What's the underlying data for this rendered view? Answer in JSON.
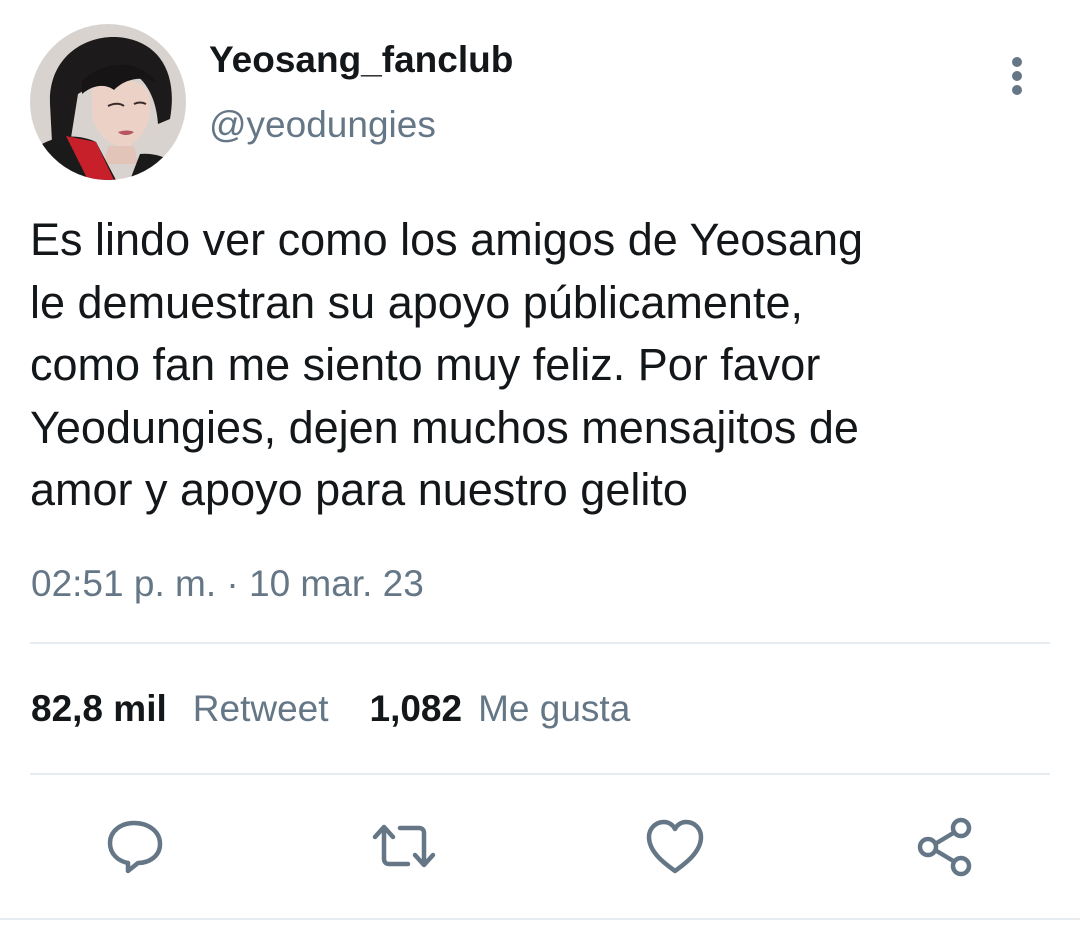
{
  "author": {
    "display_name": "Yeosang_fanclub",
    "handle": "@yeodungies"
  },
  "tweet": {
    "lines": [
      "Es lindo ver como los amigos de Yeosang",
      "le demuestran su apoyo públicamente,",
      "como fan me siento muy feliz. Por favor",
      "Yeodungies, dejen muchos mensajitos de",
      "amor y apoyo para nuestro gelito"
    ],
    "timestamp": "02:51 p. m. · 10 mar. 23"
  },
  "stats": {
    "retweets_count": "82,8 mil",
    "retweets_label": "Retweet",
    "likes_count": "1,082",
    "likes_label": "Me gusta"
  },
  "actions": [
    {
      "icon": "reply-icon"
    },
    {
      "icon": "retweet-icon"
    },
    {
      "icon": "like-icon"
    },
    {
      "icon": "share-icon"
    }
  ],
  "colors": {
    "text_primary": "#14171a",
    "text_secondary": "#657786",
    "icon": "#657786",
    "divider": "#e6ecf0"
  }
}
